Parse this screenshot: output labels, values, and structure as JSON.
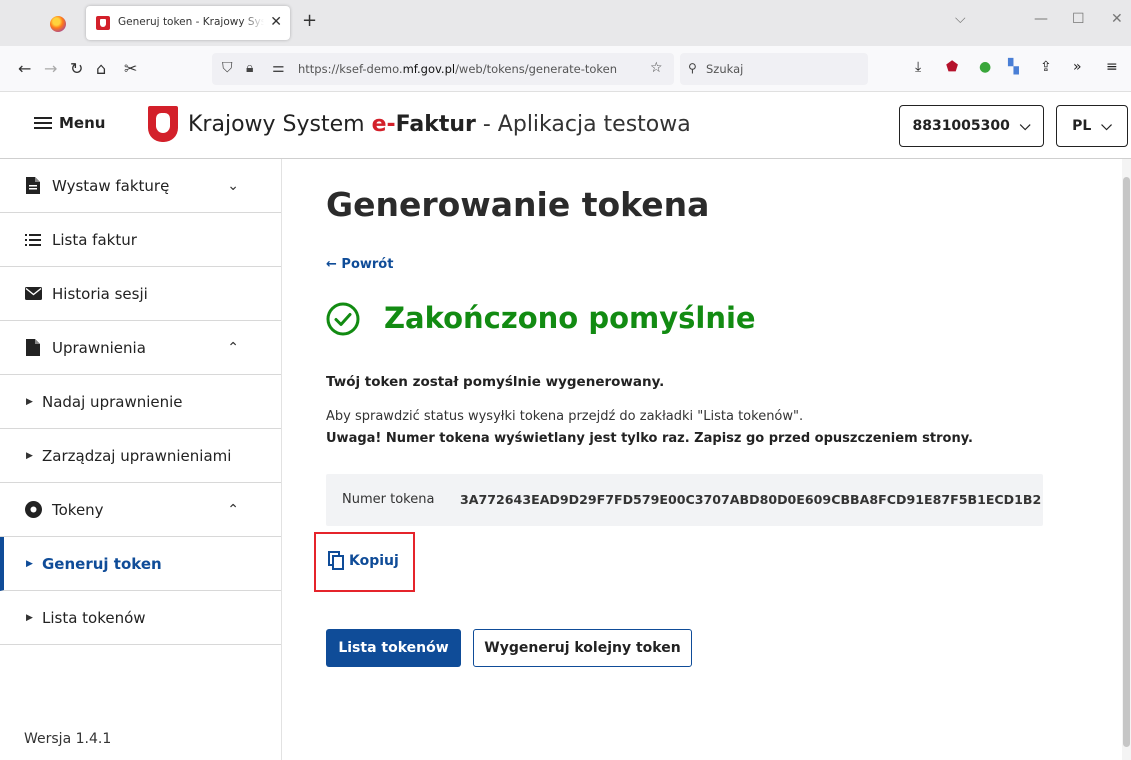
{
  "browser": {
    "tab_title": "Generuj token - Krajowy System e-Faktur",
    "tab_close": "✕",
    "new_tab": "+",
    "url_prefix": "https://ksef-demo.",
    "url_domain": "mf.gov.pl",
    "url_path": "/web/tokens/generate-token",
    "search_placeholder": "Szukaj"
  },
  "header": {
    "menu_label": "Menu",
    "brand_prefix": "Krajowy System ",
    "brand_e": "e-",
    "brand_faktur": "Faktur",
    "brand_suffix": " - Aplikacja testowa",
    "nip_value": "8831005300",
    "lang_value": "PL"
  },
  "sidebar": {
    "items": [
      {
        "label": "Wystaw fakturę",
        "chevron": "⌄"
      },
      {
        "label": "Lista faktur"
      },
      {
        "label": "Historia sesji"
      },
      {
        "label": "Uprawnienia",
        "chevron": "⌃"
      },
      {
        "label": "Nadaj uprawnienie"
      },
      {
        "label": "Zarządzaj uprawnieniami"
      },
      {
        "label": "Tokeny",
        "chevron": "⌃"
      },
      {
        "label": "Generuj token"
      },
      {
        "label": "Lista tokenów"
      }
    ],
    "version": "Wersja 1.4.1"
  },
  "main": {
    "title": "Generowanie tokena",
    "back_label": "← Powrót",
    "success_title": "Zakończono pomyślnie",
    "success_message": "Twój token został pomyślnie wygenerowany.",
    "status_hint": "Aby sprawdzić status wysyłki tokena przejdź do zakładki \"Lista tokenów\".",
    "warning": "Uwaga! Numer tokena wyświetlany jest tylko raz. Zapisz go przed opuszczeniem strony.",
    "token_label": "Numer tokena",
    "token_value": "3A772643EAD9D29F7FD579E00C3707ABD80D0E609CBBA8FCD91E87F5B1ECD1B2",
    "copy_label": "Kopiuj",
    "btn_list": "Lista tokenów",
    "btn_generate": "Wygeneruj kolejny token"
  },
  "colors": {
    "primary": "#0f4c98",
    "success": "#128b12",
    "highlight": "#e5242b",
    "brand_red": "#d3202a"
  }
}
